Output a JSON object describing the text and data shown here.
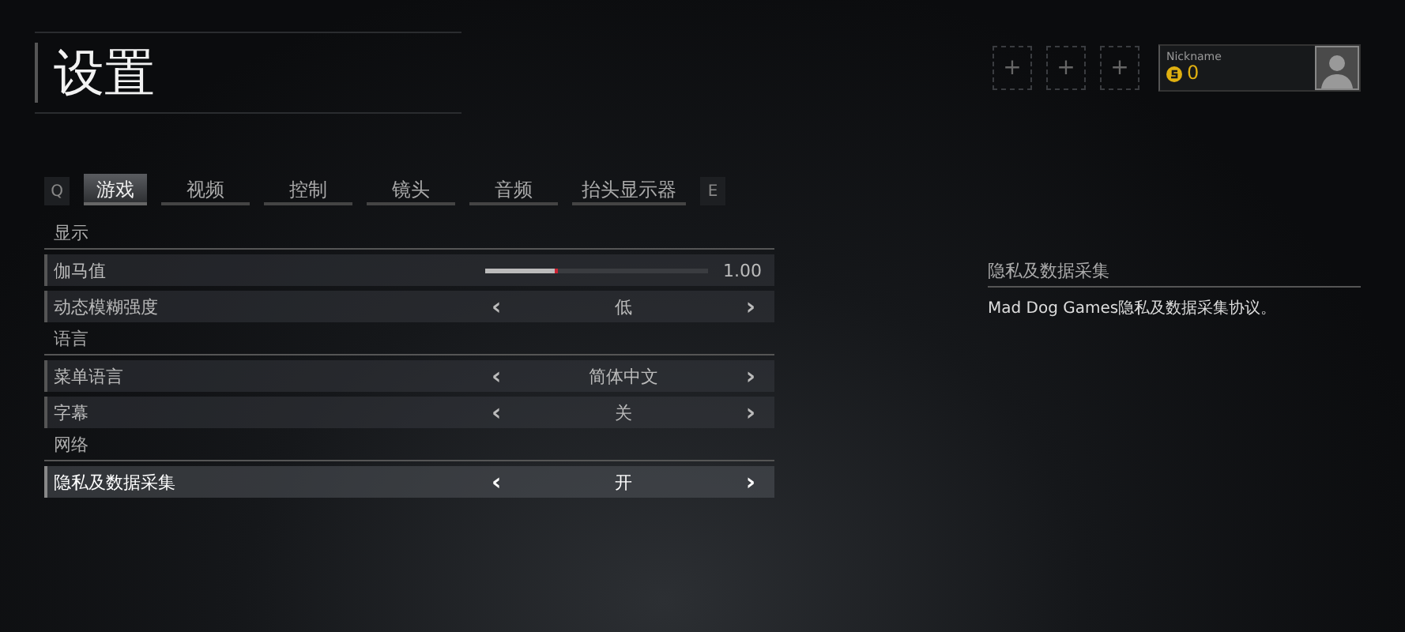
{
  "title": "设置",
  "profile": {
    "slots": [
      "+",
      "+",
      "+"
    ],
    "nickname": "Nickname",
    "currency": "0"
  },
  "tabs": {
    "prev_key": "Q",
    "next_key": "E",
    "items": [
      {
        "label": "游戏",
        "selected": true
      },
      {
        "label": "视频",
        "selected": false
      },
      {
        "label": "控制",
        "selected": false
      },
      {
        "label": "镜头",
        "selected": false
      },
      {
        "label": "音频",
        "selected": false
      },
      {
        "label": "抬头显示器",
        "selected": false
      }
    ]
  },
  "sections": [
    {
      "heading": "显示",
      "rows": [
        {
          "kind": "slider",
          "label": "伽马值",
          "level": 0.31,
          "reading": "1.00",
          "selected": false
        },
        {
          "kind": "choice",
          "label": "动态模糊强度",
          "value": "低",
          "prev": "‹",
          "next": "›",
          "selected": false
        }
      ]
    },
    {
      "heading": "语言",
      "rows": [
        {
          "kind": "choice",
          "label": "菜单语言",
          "value": "简体中文",
          "prev": "‹",
          "next": "›",
          "selected": false
        },
        {
          "kind": "choice",
          "label": "字幕",
          "value": "关",
          "prev": "‹",
          "next": "›",
          "selected": false
        }
      ]
    },
    {
      "heading": "网络",
      "rows": [
        {
          "kind": "choice",
          "label": "隐私及数据采集",
          "value": "开",
          "prev": "‹",
          "next": "›",
          "selected": true
        }
      ]
    }
  ],
  "info": {
    "heading": "隐私及数据采集",
    "text": "Mad Dog Games隐私及数据采集协议。"
  }
}
